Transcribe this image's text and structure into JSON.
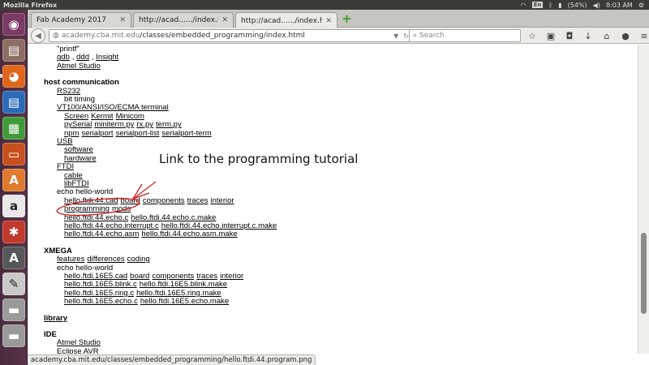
{
  "topbar": {
    "title": "Mozilla Firefox",
    "keyboard": "En",
    "battery": "(54%)",
    "time": "8:03 AM"
  },
  "launcher": {
    "items": [
      {
        "name": "ubuntu-dash-icon",
        "glyph": "◉",
        "color": "#7a3b64"
      },
      {
        "name": "files-icon",
        "glyph": "▤",
        "color": "#8d6e63"
      },
      {
        "name": "firefox-icon",
        "glyph": "◕",
        "color": "#e0661a"
      },
      {
        "name": "writer-icon",
        "glyph": "▤",
        "color": "#2a6bb8"
      },
      {
        "name": "calc-icon",
        "glyph": "▦",
        "color": "#3f9b3a"
      },
      {
        "name": "impress-icon",
        "glyph": "▭",
        "color": "#c8501e"
      },
      {
        "name": "software-center-icon",
        "glyph": "A",
        "color": "#e07a2c"
      },
      {
        "name": "amazon-icon",
        "glyph": "a",
        "color": "#e9e9e9"
      },
      {
        "name": "settings-icon",
        "glyph": "✱",
        "color": "#c0392b"
      },
      {
        "name": "updater-icon",
        "glyph": "A",
        "color": "#55575a"
      },
      {
        "name": "text-editor-icon",
        "glyph": "✎",
        "color": "#c9c9c9"
      },
      {
        "name": "drive-icon",
        "glyph": "▬",
        "color": "#9a9a9a"
      },
      {
        "name": "drive-icon-2",
        "glyph": "▬",
        "color": "#9a9a9a"
      }
    ]
  },
  "tabs": [
    {
      "label": "Fab Academy 2017",
      "active": false
    },
    {
      "label": "http://acad....../index.html",
      "active": false
    },
    {
      "label": "http://acad....../index.html",
      "active": true
    }
  ],
  "nav": {
    "url_prefix": "academy.cba.mit.edu",
    "url_path": "/classes/embedded_programming/index.html",
    "search_placeholder": "Search"
  },
  "content": {
    "lines": [
      {
        "indent": 2,
        "parts": [
          {
            "t": "\"printf\""
          }
        ]
      },
      {
        "indent": 2,
        "parts": [
          {
            "t": "gdb",
            "link": true
          },
          {
            "t": ",",
            "link": false
          },
          {
            "t": "ddd",
            "link": true
          },
          {
            "t": ",",
            "link": false
          },
          {
            "t": "Insight",
            "link": true
          }
        ]
      },
      {
        "indent": 2,
        "parts": [
          {
            "t": "Atmel Studio",
            "link": true
          }
        ]
      },
      {
        "indent": 0,
        "gap": true,
        "parts": [
          {
            "t": "host communication",
            "bold": true
          }
        ]
      },
      {
        "indent": 2,
        "parts": [
          {
            "t": "RS232",
            "link": true
          }
        ]
      },
      {
        "indent": 3,
        "parts": [
          {
            "t": "bit timing"
          }
        ]
      },
      {
        "indent": 2,
        "parts": [
          {
            "t": "VT100/ANSI/ISO/ECMA terminal",
            "link": true
          }
        ]
      },
      {
        "indent": 3,
        "parts": [
          {
            "t": "Screen",
            "link": true
          },
          {
            "t": "Kermit",
            "link": true
          },
          {
            "t": "Minicom",
            "link": true
          }
        ]
      },
      {
        "indent": 3,
        "parts": [
          {
            "t": "pySerial",
            "link": true
          },
          {
            "t": "miniterm.py",
            "link": true
          },
          {
            "t": "rx.py",
            "link": true
          },
          {
            "t": "term.py",
            "link": true
          }
        ]
      },
      {
        "indent": 3,
        "parts": [
          {
            "t": "npm",
            "link": true
          },
          {
            "t": "serialport",
            "link": true
          },
          {
            "t": "serialport-list",
            "link": true
          },
          {
            "t": "serialport-term",
            "link": true
          }
        ]
      },
      {
        "indent": 2,
        "parts": [
          {
            "t": "USB",
            "link": true
          }
        ]
      },
      {
        "indent": 3,
        "parts": [
          {
            "t": "software",
            "link": true
          }
        ]
      },
      {
        "indent": 3,
        "parts": [
          {
            "t": "hardware",
            "link": true
          }
        ]
      },
      {
        "indent": 2,
        "parts": [
          {
            "t": "FTDI",
            "link": true
          }
        ]
      },
      {
        "indent": 3,
        "parts": [
          {
            "t": "cable",
            "link": true
          }
        ]
      },
      {
        "indent": 3,
        "parts": [
          {
            "t": "libFTDI",
            "link": true
          }
        ]
      },
      {
        "indent": 2,
        "parts": [
          {
            "t": "echo hello-world"
          }
        ]
      },
      {
        "indent": 3,
        "parts": [
          {
            "t": "hello.ftdi.44.cad",
            "link": true
          },
          {
            "t": "board",
            "link": true
          },
          {
            "t": "components",
            "link": true
          },
          {
            "t": "traces",
            "link": true
          },
          {
            "t": "interior",
            "link": true
          }
        ]
      },
      {
        "indent": 3,
        "parts": [
          {
            "t": "programming",
            "link": true
          },
          {
            "t": "mods",
            "link": true
          }
        ]
      },
      {
        "indent": 3,
        "parts": [
          {
            "t": "hello.ftdi.44.echo.c",
            "link": true
          },
          {
            "t": "hello.ftdi.44.echo.c.make",
            "link": true
          }
        ]
      },
      {
        "indent": 3,
        "parts": [
          {
            "t": "hello.ftdi.44.echo.interrupt.c",
            "link": true
          },
          {
            "t": "hello.ftdi.44.echo.interrupt.c.make",
            "link": true
          }
        ]
      },
      {
        "indent": 3,
        "parts": [
          {
            "t": "hello.ftdi.44.echo.asm",
            "link": true
          },
          {
            "t": "hello.ftdi.44.echo.asm.make",
            "link": true
          }
        ]
      },
      {
        "indent": 0,
        "gap": true,
        "parts": [
          {
            "t": "XMEGA",
            "bold": true
          }
        ]
      },
      {
        "indent": 2,
        "parts": [
          {
            "t": "features",
            "link": true
          },
          {
            "t": "differences",
            "link": true
          },
          {
            "t": "coding",
            "link": true
          }
        ]
      },
      {
        "indent": 2,
        "parts": [
          {
            "t": "echo hello-world"
          }
        ]
      },
      {
        "indent": 3,
        "parts": [
          {
            "t": "hello.ftdi.16E5.cad",
            "link": true
          },
          {
            "t": "board",
            "link": true
          },
          {
            "t": "components",
            "link": true
          },
          {
            "t": "traces",
            "link": true
          },
          {
            "t": "interior",
            "link": true
          }
        ]
      },
      {
        "indent": 3,
        "parts": [
          {
            "t": "hello.ftdi.16E5.blink.c",
            "link": true
          },
          {
            "t": "hello.ftdi.16E5.blink.make",
            "link": true
          }
        ]
      },
      {
        "indent": 3,
        "parts": [
          {
            "t": "hello.ftdi.16E5.ring.c",
            "link": true
          },
          {
            "t": "hello.ftdi.16E5.ring.make",
            "link": true
          }
        ]
      },
      {
        "indent": 3,
        "parts": [
          {
            "t": "hello.ftdi.16E5.echo.c",
            "link": true
          },
          {
            "t": "hello.ftdi.16E5.echo.make",
            "link": true
          }
        ]
      },
      {
        "indent": 0,
        "gap": true,
        "parts": [
          {
            "t": "library",
            "bold": true,
            "link": true
          }
        ]
      },
      {
        "indent": 0,
        "gap": true,
        "parts": [
          {
            "t": "IDE",
            "bold": true
          }
        ]
      },
      {
        "indent": 2,
        "parts": [
          {
            "t": "Atmel Studio",
            "link": true
          }
        ]
      },
      {
        "indent": 2,
        "parts": [
          {
            "t": "Eclipse AVR",
            "link": true
          }
        ]
      }
    ]
  },
  "annotation": {
    "text": "Link to the programming tutorial",
    "color": "#d42020"
  },
  "status": {
    "text": "academy.cba.mit.edu/classes/embedded_programming/hello.ftdi.44.program.png"
  }
}
